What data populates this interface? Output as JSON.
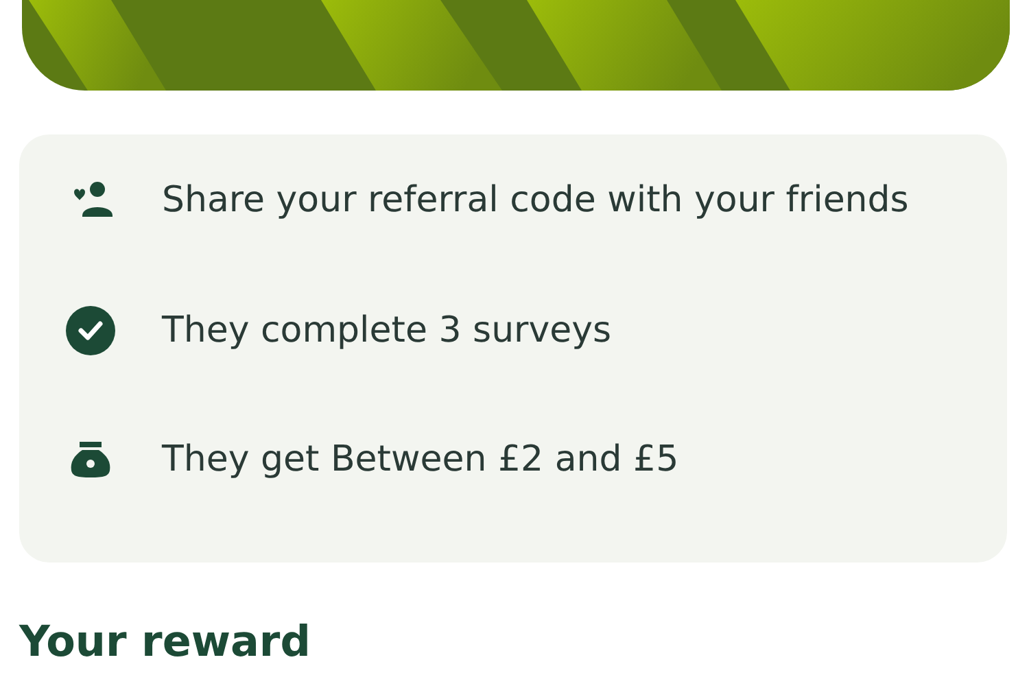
{
  "steps": [
    {
      "kind": "friends",
      "text": "Share your referral code with your friends"
    },
    {
      "kind": "check",
      "text": "They complete 3 surveys"
    },
    {
      "kind": "moneybag",
      "text": "They get Between £2 and £5"
    }
  ],
  "heading": "Your reward"
}
